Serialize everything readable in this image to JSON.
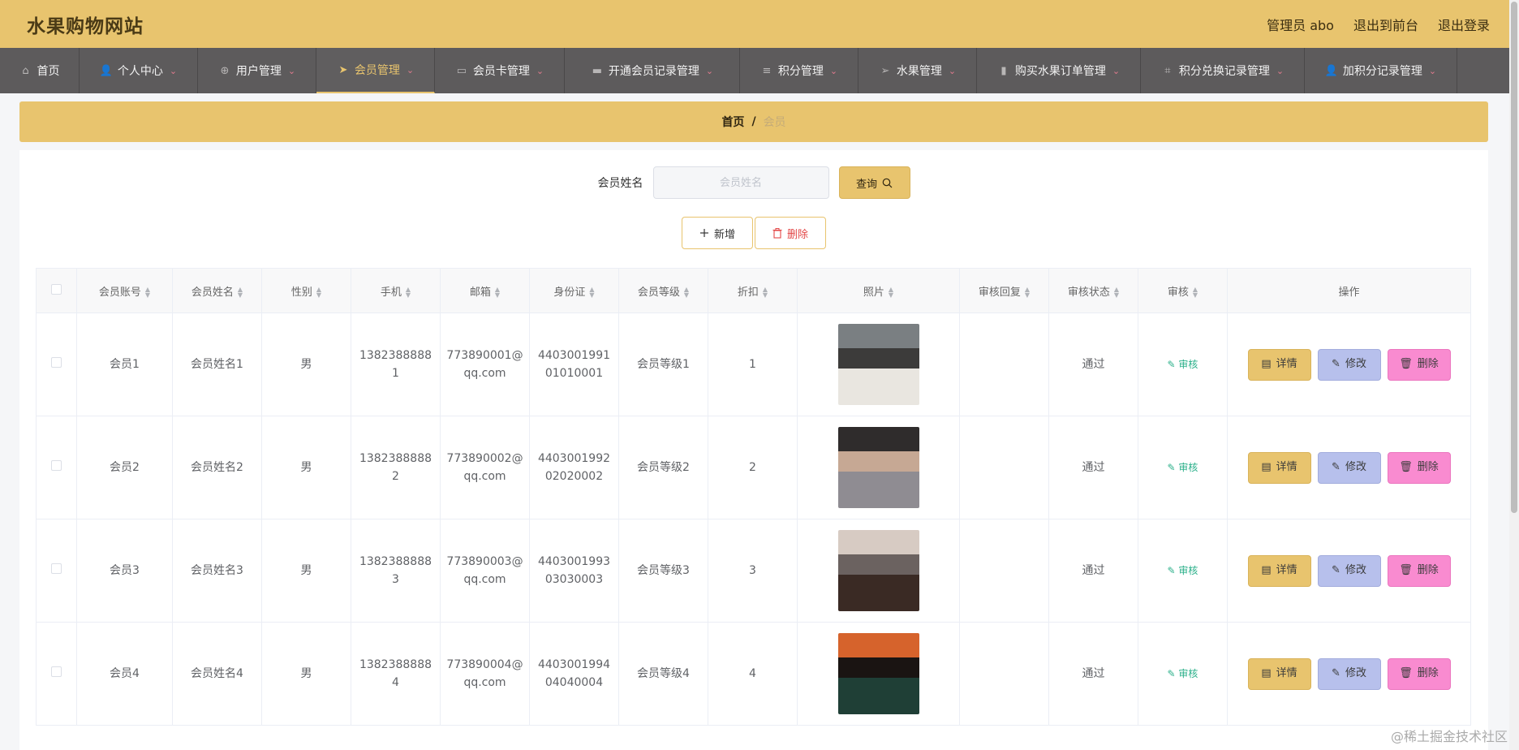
{
  "header": {
    "title": "水果购物网站",
    "admin": "管理员 abo",
    "back_front": "退出到前台",
    "logout": "退出登录"
  },
  "nav": [
    {
      "label": "首页",
      "icon": "home-icon",
      "glyph": "⌂",
      "caret": false,
      "active": false
    },
    {
      "label": "个人中心",
      "icon": "user-icon",
      "glyph": "👤",
      "caret": true,
      "active": false
    },
    {
      "label": "用户管理",
      "icon": "crosshair-icon",
      "glyph": "⊕",
      "caret": true,
      "active": false
    },
    {
      "label": "会员管理",
      "icon": "send-icon",
      "glyph": "➤",
      "caret": true,
      "active": true
    },
    {
      "label": "会员卡管理",
      "icon": "monitor-icon",
      "glyph": "▭",
      "caret": true,
      "active": false
    },
    {
      "label": "开通会员记录管理",
      "icon": "ticket-icon",
      "glyph": "▬",
      "caret": true,
      "active": false
    },
    {
      "label": "积分管理",
      "icon": "list-icon",
      "glyph": "≡",
      "caret": true,
      "active": false
    },
    {
      "label": "水果管理",
      "icon": "navigation-icon",
      "glyph": "➢",
      "caret": true,
      "active": false
    },
    {
      "label": "购买水果订单管理",
      "icon": "chart-icon",
      "glyph": "▮",
      "caret": true,
      "active": false
    },
    {
      "label": "积分兑换记录管理",
      "icon": "crop-icon",
      "glyph": "⌗",
      "caret": true,
      "active": false
    },
    {
      "label": "加积分记录管理",
      "icon": "person-icon",
      "glyph": "👤",
      "caret": true,
      "active": false
    }
  ],
  "breadcrumb": {
    "home": "首页",
    "sep": "/",
    "current": "会员"
  },
  "search": {
    "label": "会员姓名",
    "placeholder": "会员姓名",
    "query_label": "查询"
  },
  "actions": {
    "add_label": "新增",
    "delete_label": "删除"
  },
  "table": {
    "columns": [
      "会员账号",
      "会员姓名",
      "性别",
      "手机",
      "邮箱",
      "身份证",
      "会员等级",
      "折扣",
      "照片",
      "审核回复",
      "审核状态",
      "审核",
      "操作"
    ],
    "review_link": "审核",
    "detail_label": "详情",
    "edit_label": "修改",
    "delete_label": "删除",
    "rows": [
      {
        "account": "会员1",
        "name": "会员姓名1",
        "gender": "男",
        "phone": "13823888881",
        "email": "773890001@qq.com",
        "idcard": "440300199101010001",
        "level": "会员等级1",
        "discount": "1",
        "reply": "",
        "status": "通过",
        "photo_colors": [
          "#7a7f82",
          "#e9e6e0",
          "#3c3b3a"
        ]
      },
      {
        "account": "会员2",
        "name": "会员姓名2",
        "gender": "男",
        "phone": "13823888882",
        "email": "773890002@qq.com",
        "idcard": "440300199202020002",
        "level": "会员等级2",
        "discount": "2",
        "reply": "",
        "status": "通过",
        "photo_colors": [
          "#2f2c2c",
          "#8f8c92",
          "#c6a894"
        ]
      },
      {
        "account": "会员3",
        "name": "会员姓名3",
        "gender": "男",
        "phone": "13823888883",
        "email": "773890003@qq.com",
        "idcard": "440300199303030003",
        "level": "会员等级3",
        "discount": "3",
        "reply": "",
        "status": "通过",
        "photo_colors": [
          "#d7cbc3",
          "#3a2a24",
          "#6b6260"
        ]
      },
      {
        "account": "会员4",
        "name": "会员姓名4",
        "gender": "男",
        "phone": "13823888884",
        "email": "773890004@qq.com",
        "idcard": "440300199404040004",
        "level": "会员等级4",
        "discount": "4",
        "reply": "",
        "status": "通过",
        "photo_colors": [
          "#d6632c",
          "#1f3f36",
          "#1a1412"
        ]
      }
    ]
  },
  "watermark": "@稀土掘金技术社区"
}
